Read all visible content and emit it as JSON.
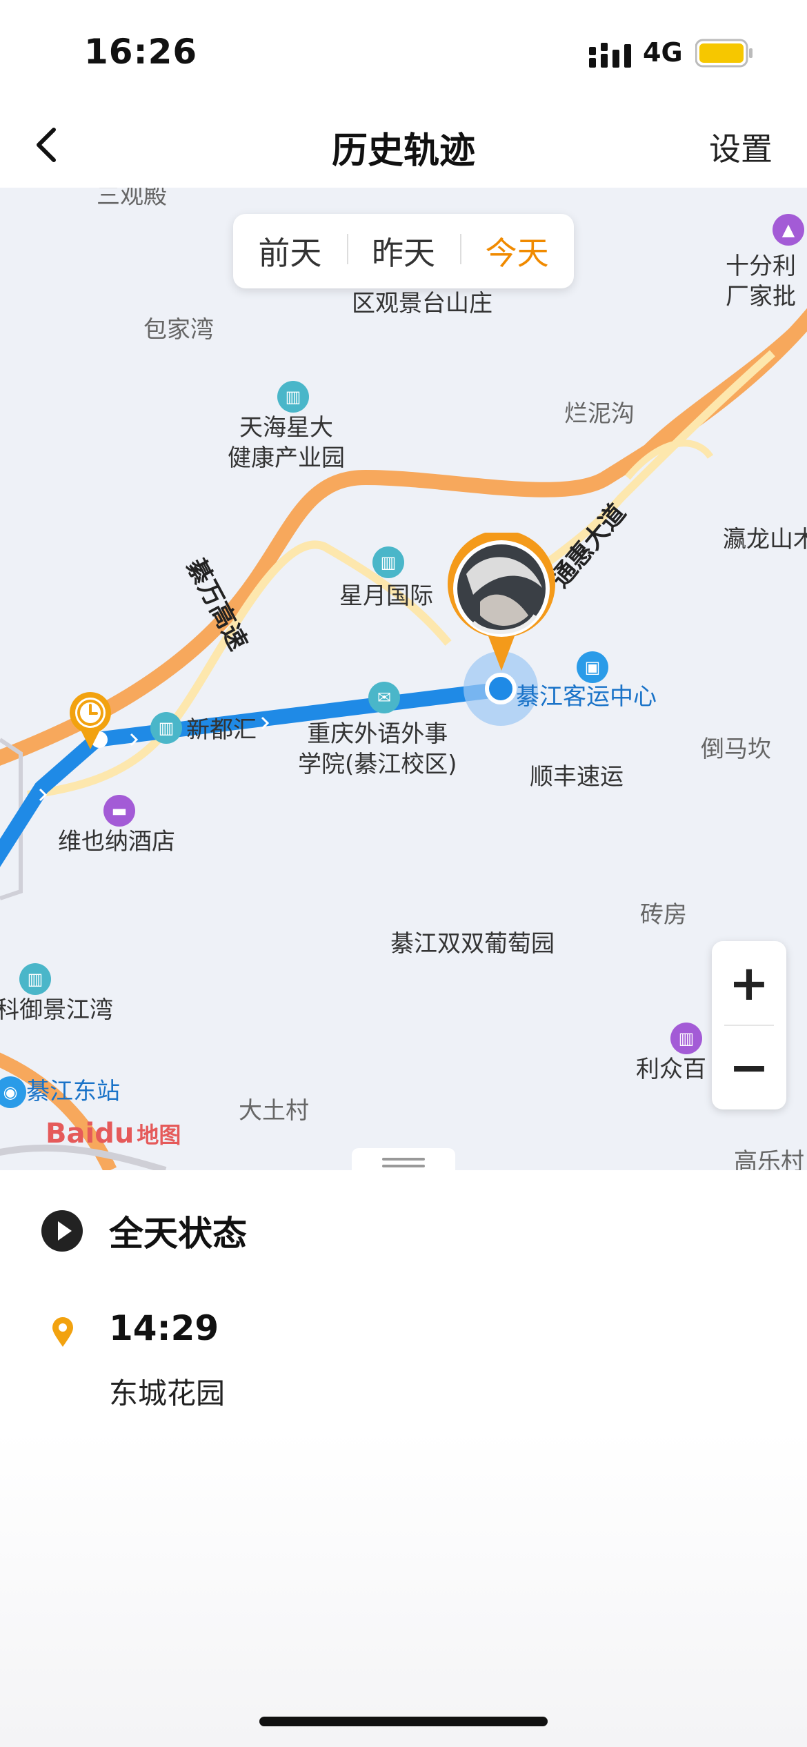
{
  "status_bar": {
    "time": "16:26",
    "network": "4G"
  },
  "nav": {
    "title": "历史轨迹",
    "settings": "设置"
  },
  "day_tabs": [
    {
      "label": "前天",
      "active": false
    },
    {
      "label": "昨天",
      "active": false
    },
    {
      "label": "今天",
      "active": true
    }
  ],
  "map": {
    "places": {
      "sanguandian": "三观殿",
      "guanjingtai": "区观景台山庄",
      "baojiawan": "包家湾",
      "tianhai": "天海星大\n健康产业园",
      "lanniguo": "烂泥沟",
      "shifenli": "十分利\n厂家批",
      "yinglongshan": "瀛龙山木",
      "xingyue": "星月国际",
      "tonghui": "通惠大道",
      "qijiang_express": "綦万高速",
      "keyun": "綦江客运中心",
      "xindu": "新都汇",
      "chongqing_foreign": "重庆外语外事\n学院(綦江校区)",
      "daomakan": "倒马坎",
      "shunfeng": "顺丰速运",
      "weiyena": "维也纳酒店",
      "zhuanfang": "砖房",
      "putao": "綦江双双葡萄园",
      "jingjiangwan": "科御景江湾",
      "lizhong": "利众百",
      "dongzhan": "綦江东站",
      "datucun": "大土村",
      "gaole": "高乐村"
    },
    "baidu_logo": "Baidu",
    "baidu_map_word": "地图"
  },
  "zoom": {
    "in": "+",
    "out": "−"
  },
  "sheet": {
    "all_day": "全天状态",
    "stop_time": "14:29",
    "stop_place": "东城花园"
  }
}
